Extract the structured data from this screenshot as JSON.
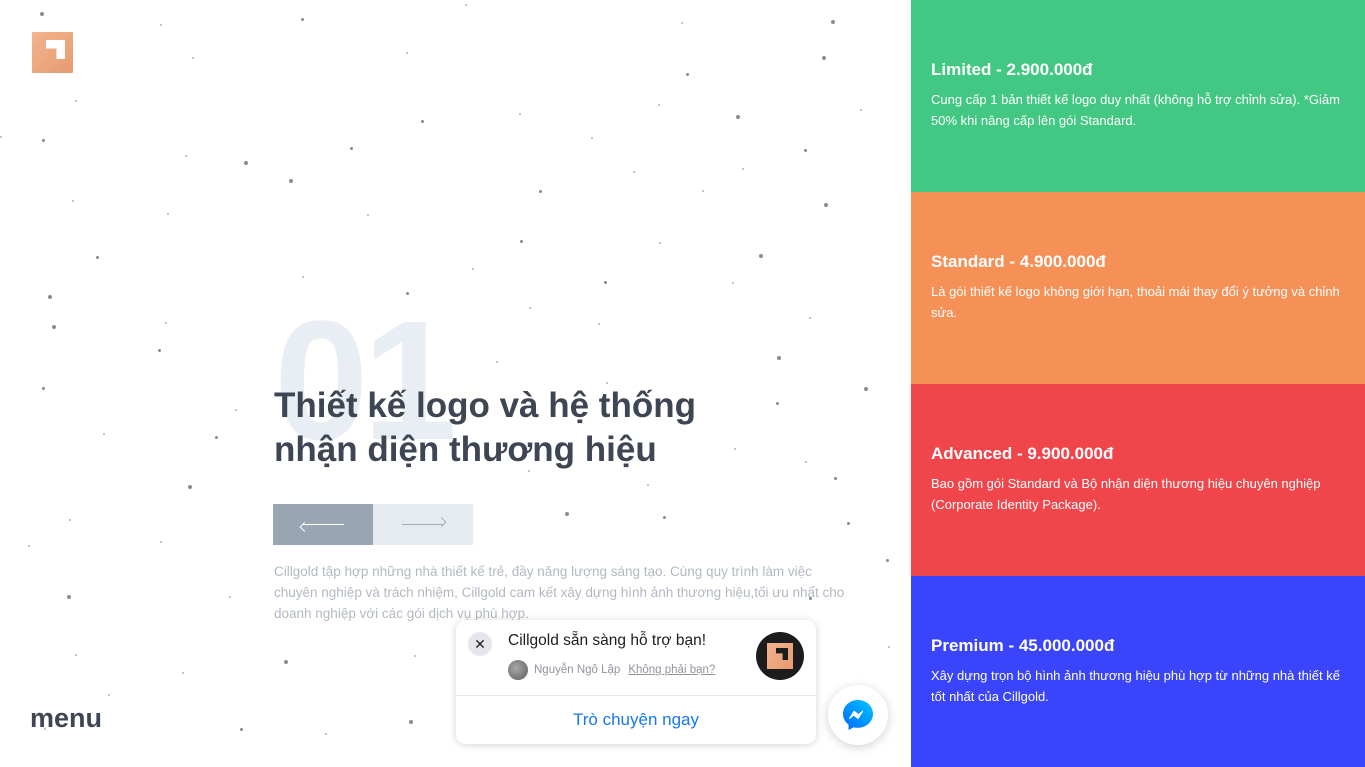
{
  "brand": {
    "logo_icon": "cillgold-logo-icon"
  },
  "hero": {
    "number": "01",
    "title_line1": "Thiết kế logo và hệ thống",
    "title_line2": "nhận diện thương hiệu",
    "description": "Cillgold tập hợp những nhà thiết kế trẻ, đầy năng lượng sáng tạo. Cùng quy trình làm việc chuyên nghiệp và trách nhiệm, Cillgold cam kết xây dựng hình ảnh thương hiệu,tối ưu nhất cho doanh nghiệp với các gói dịch vụ phù hợp.",
    "prev_icon": "arrow-left-icon",
    "next_icon": "arrow-right-icon"
  },
  "menu_label": "menu",
  "packages": [
    {
      "title": "Limited - 2.900.000đ",
      "description": "Cung cấp 1 bản thiết kế logo duy nhất (không hỗ trợ chỉnh sửa). *Giảm 50% khi nâng cấp lên gói Standard.",
      "color": "#42c882"
    },
    {
      "title": "Standard - 4.900.000đ",
      "description": "Là gói thiết kế logo không giới hạn, thoải mái thay đổi ý tưởng và chỉnh sửa.",
      "color": "#f59057"
    },
    {
      "title": "Advanced - 9.900.000đ",
      "description": "Bao gồm gói Standard và Bộ nhận diện thương hiệu chuyên nghiệp (Corporate Identity Package).",
      "color": "#f0464b"
    },
    {
      "title": "Premium - 45.000.000đ",
      "description": "Xây dựng trọn bộ hình ảnh thương hiệu phù hợp từ những nhà thiết kế tốt nhất của Cillgold.",
      "color": "#3a44fa"
    }
  ],
  "chat": {
    "title": "Cillgold sẵn sàng hỗ trợ bạn!",
    "user_name": "Nguyễn Ngô Lập",
    "not_you": "Không phải bạn?",
    "cta": "Trò chuyện ngay",
    "close_symbol": "✕",
    "messenger_icon": "messenger-icon"
  }
}
